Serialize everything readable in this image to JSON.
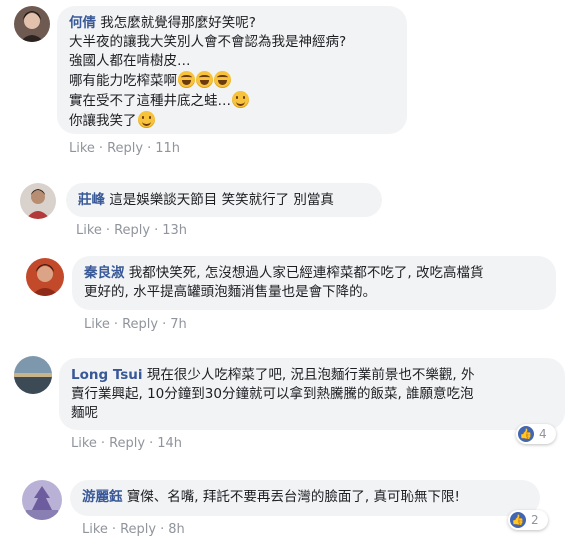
{
  "comments": [
    {
      "name": "何倩",
      "lines": [
        "我怎麼就覺得那麼好笑呢?",
        "大半夜的讓我大笑別人會不會認為我是神經病?",
        "強國人都在啃樹皮…",
        "哪有能力吃榨菜啊",
        "實在受不了這種井底之蛙…",
        "你讓我笑了"
      ],
      "like": "Like",
      "reply": "Reply",
      "time": "11h"
    },
    {
      "name": "莊峰",
      "lines": [
        "這是娛樂談天節目 笑笑就行了 別當真"
      ],
      "like": "Like",
      "reply": "Reply",
      "time": "13h"
    },
    {
      "name": "秦良淑",
      "lines": [
        "我都快笑死, 怎沒想過人家已經連榨菜都不吃了, 改吃高檔貨",
        "更好的, 水平提高罐頭泡麵消售量也是會下降的。"
      ],
      "like": "Like",
      "reply": "Reply",
      "time": "7h"
    },
    {
      "name": "Long Tsui",
      "lines": [
        "現在很少人吃榨菜了吧, 況且泡麵行業前景也不樂觀, 外",
        "賣行業興起, 10分鐘到30分鐘就可以拿到熱騰騰的飯菜, 誰願意吃泡",
        "麵呢"
      ],
      "like": "Like",
      "reply": "Reply",
      "time": "14h",
      "reaction_count": "4"
    },
    {
      "name": "游麗鈺",
      "lines": [
        "寶傑、名嘴, 拜託不要再丟台灣的臉面了, 真可恥無下限!"
      ],
      "like": "Like",
      "reply": "Reply",
      "time": "8h",
      "reaction_count": "2"
    }
  ],
  "icons": {
    "laugh": "laughing-emoji-icon",
    "smile": "smiling-emoji-icon",
    "like": "like-thumb-icon"
  },
  "colors": {
    "name": "#385898",
    "bubble": "#f2f3f5",
    "meta": "#90949c",
    "like_badge": "#4267b2"
  }
}
